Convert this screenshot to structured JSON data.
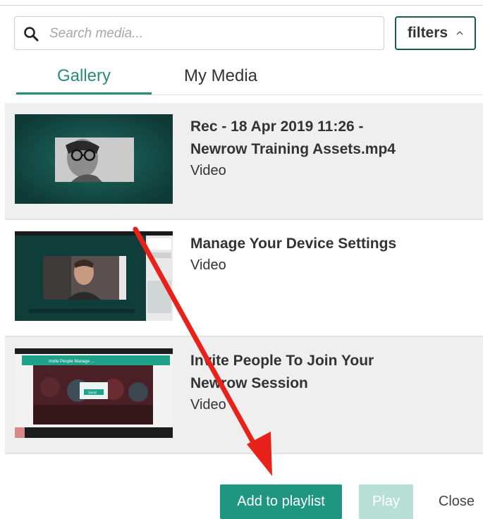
{
  "search": {
    "placeholder": "Search media..."
  },
  "filters": {
    "label": "filters"
  },
  "tabs": [
    {
      "label": "Gallery",
      "active": true
    },
    {
      "label": "My Media",
      "active": false
    }
  ],
  "media": [
    {
      "title_line1": "Rec - 18 Apr 2019 11:26 -",
      "title_line2": "Newrow Training Assets.mp4",
      "type": "Video",
      "selected": true
    },
    {
      "title_line1": "Manage Your Device Settings",
      "title_line2": "",
      "type": "Video",
      "selected": false
    },
    {
      "title_line1": "Invite People To Join Your",
      "title_line2": "Newrow Session",
      "type": "Video",
      "selected": true
    }
  ],
  "thumb3": {
    "header_text": "Invite People Manage ...",
    "dialog_button": "Send"
  },
  "footer": {
    "add_label": "Add to playlist",
    "play_label": "Play",
    "close_label": "Close"
  },
  "colors": {
    "accent": "#1f9682",
    "tab_active": "#2a8a7c",
    "thumb_bg": "#134a45",
    "annotation_arrow": "#e8221b"
  }
}
